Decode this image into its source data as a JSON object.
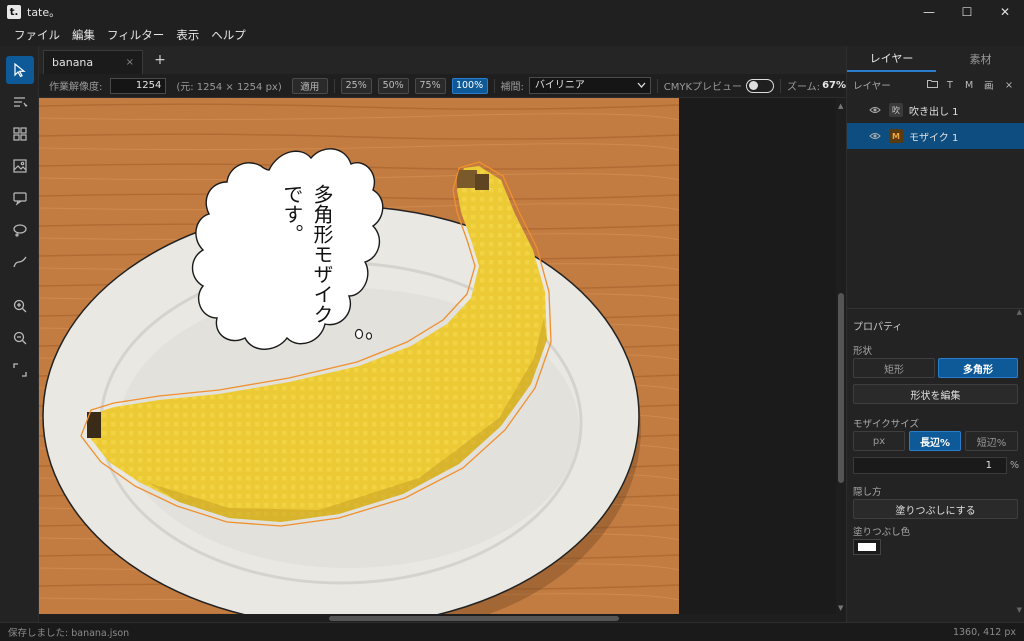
{
  "app": {
    "logo": "t.",
    "title": "tate。"
  },
  "window_controls": {
    "minimize": "—",
    "maximize": "☐",
    "close": "✕"
  },
  "menu": [
    "ファイル",
    "編集",
    "フィルター",
    "表示",
    "ヘルプ"
  ],
  "tools": [
    "select-arrow-icon",
    "text-lines-icon",
    "grid-icon",
    "image-icon",
    "speech-bubble-icon",
    "thought-bubble-icon",
    "pen-curve-icon",
    "zoom-in-icon",
    "zoom-out-icon",
    "fit-screen-icon"
  ],
  "document_tab": {
    "label": "banana",
    "close": "×",
    "add": "+"
  },
  "options": {
    "resolution_label": "作業解像度:",
    "resolution_value": "1254",
    "original_size": "(元: 1254 × 1254 px)",
    "apply": "適用",
    "presets": [
      "25%",
      "50%",
      "75%",
      "100%"
    ],
    "selected_preset": "100%",
    "interp_label": "補間:",
    "interp_value": "バイリニア",
    "cmyk_label": "CMYKプレビュー",
    "cmyk_on": false,
    "zoom_label": "ズーム:",
    "zoom_value": "67%"
  },
  "canvas": {
    "balloon_text_col1": "多角形モザイク",
    "balloon_text_col2": "です。",
    "colors": {
      "table": "#c07a3e",
      "plate": "#ecebe6",
      "banana": "#efcf3a",
      "outline": "#f0902e"
    }
  },
  "right_panel": {
    "tabs": [
      "レイヤー",
      "素材"
    ],
    "active_tab": "レイヤー",
    "layers_label": "レイヤー",
    "layer_tools": [
      "folder-icon",
      "T",
      "M",
      "画",
      "×"
    ],
    "layers": [
      {
        "badge": "吹",
        "name": "吹き出し 1",
        "selected": false
      },
      {
        "badge": "M",
        "name": "モザイク 1",
        "selected": true
      }
    ],
    "properties": {
      "title": "プロパティ",
      "shape_label": "形状",
      "shape_options": [
        "矩形",
        "多角形"
      ],
      "shape_selected": "多角形",
      "edit_shape": "形状を編集",
      "mosaic_size_label": "モザイクサイズ",
      "size_units": [
        "px",
        "長辺%",
        "短辺%"
      ],
      "size_unit_selected": "長辺%",
      "size_value": "1",
      "size_unit_suffix": "%",
      "hide_label": "隠し方",
      "hide_button": "塗りつぶしにする",
      "fill_color_label": "塗りつぶし色",
      "fill_color": "#ffffff"
    }
  },
  "status": {
    "left": "保存しました: banana.json",
    "right": "1360, 412 px"
  }
}
